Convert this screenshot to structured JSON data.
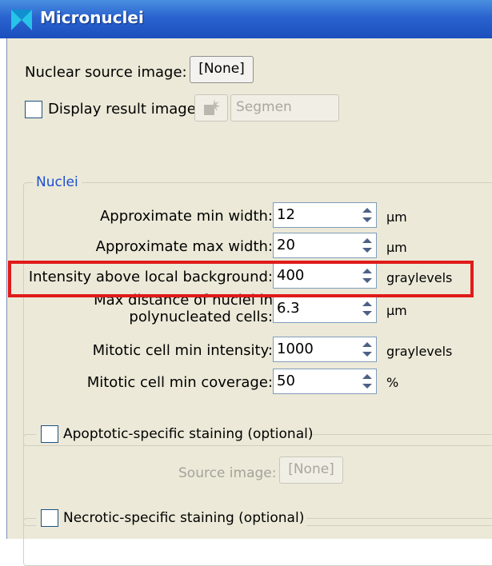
{
  "window": {
    "title": "Micronuclei"
  },
  "top": {
    "nuclear_source_label": "Nuclear source image:",
    "nuclear_source_button": "[None]",
    "display_result_label": "Display result image:",
    "display_result_checked": false,
    "segmen_button": "Segmen"
  },
  "nuclei": {
    "title": "Nuclei",
    "rows": [
      {
        "label": "Approximate min width:",
        "value": "12",
        "unit": "µm"
      },
      {
        "label": "Approximate max width:",
        "value": "20",
        "unit": "µm"
      },
      {
        "label": "Intensity above local background:",
        "value": "400",
        "unit": "graylevels"
      },
      {
        "label_line1": "Max distance of nuclei in",
        "label_line2": "polynucleated cells:",
        "value": "6.3",
        "unit": "µm"
      },
      {
        "label": "Mitotic cell min intensity:",
        "value": "1000",
        "unit": "graylevels"
      },
      {
        "label": "Mitotic cell min coverage:",
        "value": "50",
        "unit": "%"
      }
    ]
  },
  "apoptotic": {
    "title": "Apoptotic-specific staining (optional)",
    "checked": false,
    "source_label": "Source image:",
    "source_button": "[None]"
  },
  "necrotic": {
    "title": "Necrotic-specific staining (optional)",
    "checked": false
  },
  "colors": {
    "highlight": "#e01b1b",
    "titlebar": "#2a63cf",
    "panel": "#ece9d8"
  }
}
